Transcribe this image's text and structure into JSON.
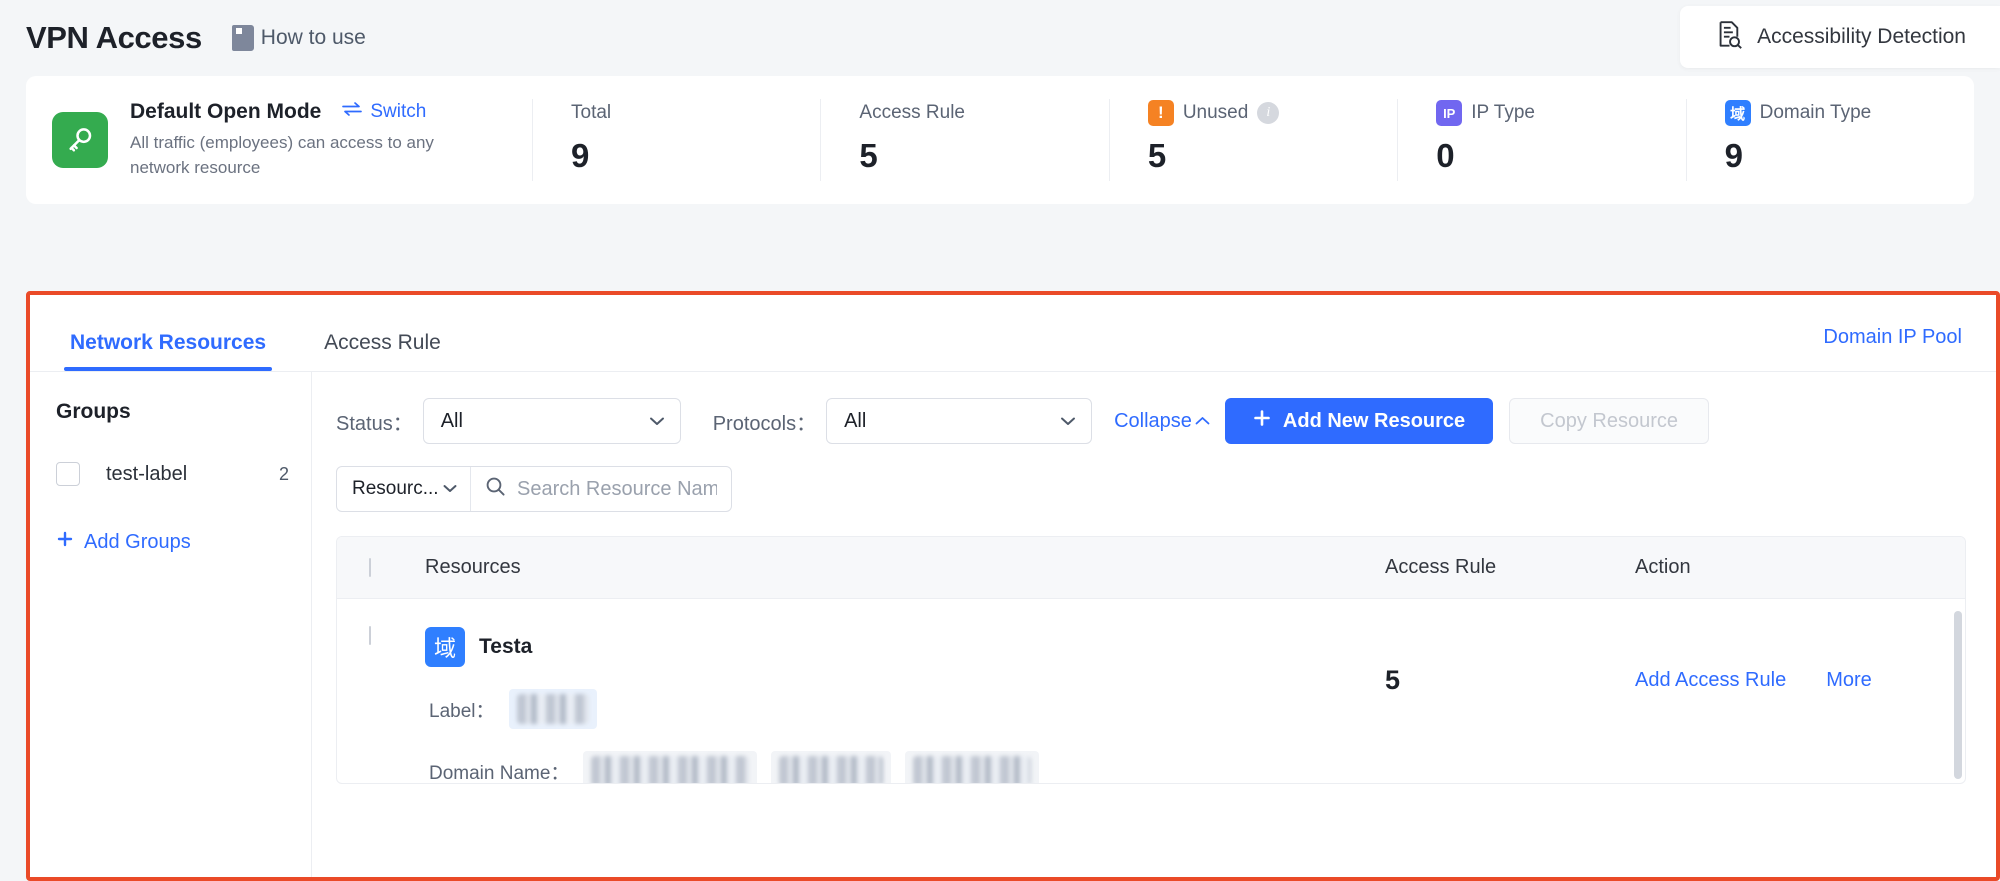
{
  "header": {
    "title": "VPN Access",
    "how_to_use": "How to use",
    "how_to_use_icon": "book-icon",
    "accessibility": {
      "label": "Accessibility Detection",
      "icon": "document-search-icon"
    }
  },
  "summary": {
    "mode": {
      "icon": "key-icon",
      "icon_color": "#34ab4f",
      "title": "Default Open Mode",
      "switch_label": "Switch",
      "switch_icon": "swap-arrows-icon",
      "description": "All traffic (employees) can access to any network resource"
    },
    "stats": [
      {
        "label": "Total",
        "value": "9",
        "badge": null,
        "info": false
      },
      {
        "label": "Access Rule",
        "value": "5",
        "badge": null,
        "info": false
      },
      {
        "label": "Unused",
        "value": "5",
        "badge": {
          "text": "!",
          "kind": "warn",
          "color": "#f58223"
        },
        "info": true
      },
      {
        "label": "IP Type",
        "value": "0",
        "badge": {
          "text": "IP",
          "kind": "ip",
          "color": "#7167f0"
        },
        "info": false
      },
      {
        "label": "Domain Type",
        "value": "9",
        "badge": {
          "text": "域",
          "kind": "dom",
          "color": "#2f7fff"
        },
        "info": false
      }
    ]
  },
  "panel": {
    "highlight_color": "#ea4a28",
    "tabs": [
      {
        "label": "Network Resources",
        "active": true
      },
      {
        "label": "Access Rule",
        "active": false
      }
    ],
    "domain_ip_pool_link": "Domain IP Pool",
    "groups": {
      "title": "Groups",
      "items": [
        {
          "label": "test-label",
          "count": "2",
          "checked": false
        }
      ],
      "add_label": "Add Groups",
      "add_icon": "plus-icon"
    },
    "filters": {
      "status_label": "Status：",
      "status_value": "All",
      "protocols_label": "Protocols：",
      "protocols_value": "All",
      "collapse_label": "Collapse",
      "collapse_icon": "chevron-up-icon",
      "add_resource_label": "Add New Resource",
      "add_resource_icon": "plus-icon",
      "copy_resource_label": "Copy Resource",
      "copy_resource_disabled": true
    },
    "search": {
      "kind_value": "Resourc...",
      "kind_icon": "chevron-down-icon",
      "placeholder": "Search Resource Name",
      "value": "",
      "icon": "search-icon"
    },
    "table": {
      "columns": [
        "Resources",
        "Access Rule",
        "Action"
      ],
      "rows": [
        {
          "checked": false,
          "type_badge": "域",
          "name": "Testa",
          "label_field": "Label：",
          "label_value": "",
          "domain_field": "Domain Name：",
          "domain_values": [
            "",
            "",
            ""
          ],
          "access_rule_count": "5",
          "actions": [
            "Add Access Rule",
            "More"
          ]
        }
      ]
    }
  }
}
